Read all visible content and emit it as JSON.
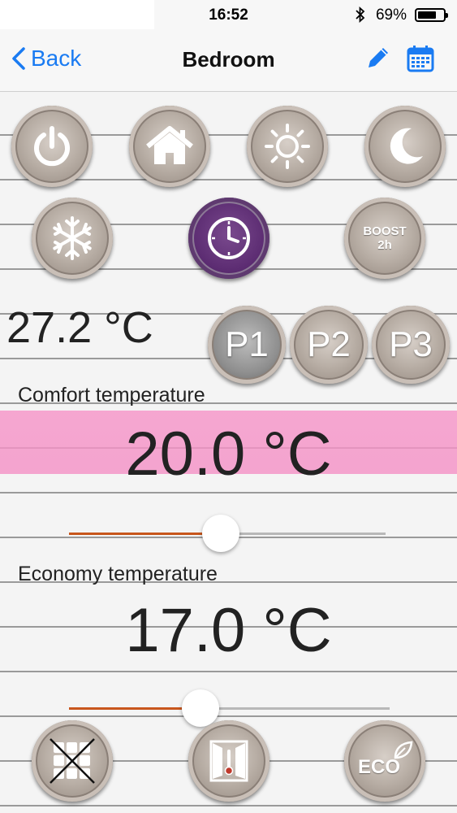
{
  "status_bar": {
    "time": "16:52",
    "battery_percent": "69%",
    "bluetooth_icon": "bluetooth-icon"
  },
  "nav": {
    "back_label": "Back",
    "title": "Bedroom",
    "edit_icon": "pencil-icon",
    "calendar_icon": "calendar-icon"
  },
  "mode_buttons_row1": [
    {
      "name": "power",
      "icon": "power-icon"
    },
    {
      "name": "home",
      "icon": "home-icon"
    },
    {
      "name": "comfort-sun",
      "icon": "sun-icon"
    },
    {
      "name": "night",
      "icon": "moon-icon"
    }
  ],
  "mode_buttons_row2": [
    {
      "name": "frost",
      "icon": "snowflake-icon"
    },
    {
      "name": "schedule",
      "icon": "clock-icon",
      "selected": true
    },
    {
      "name": "boost",
      "label_line1": "BOOST",
      "label_line2": "2h"
    }
  ],
  "current_temperature": "27.2 °C",
  "programs": {
    "p1": "P1",
    "p2": "P2",
    "p3": "P3",
    "selected": "P1"
  },
  "comfort": {
    "label": "Comfort temperature",
    "value": "20.0 °C",
    "slider_fraction": 0.48
  },
  "economy": {
    "label": "Economy temperature",
    "value": "17.0 °C",
    "slider_fraction": 0.41
  },
  "bottom_buttons": [
    {
      "name": "window-grid-off",
      "icon": "grid-crossed-icon"
    },
    {
      "name": "window-open",
      "icon": "window-thermometer-icon"
    },
    {
      "name": "eco",
      "label": "ECO",
      "icon": "leaf-icon"
    }
  ],
  "colors": {
    "accent": "#1a7bf2",
    "highlight": "#f48cc4",
    "slider_fill": "#c8561c",
    "selected_mode": "#5c2c72"
  }
}
